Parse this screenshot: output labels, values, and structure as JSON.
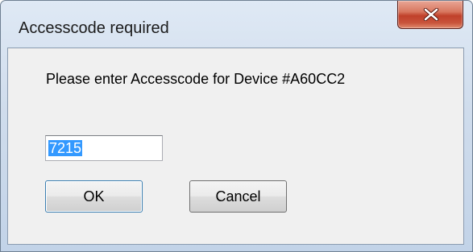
{
  "window": {
    "title": "Accesscode required"
  },
  "titlebar": {
    "close_icon": "close-x-icon"
  },
  "dialog": {
    "prompt": "Please enter Accesscode for Device #A60CC2",
    "accesscode_value": "7215",
    "ok_label": "OK",
    "cancel_label": "Cancel"
  },
  "colors": {
    "close_button": "#c8533b",
    "selection": "#3399ff",
    "titlebar": "#cfdcec"
  }
}
